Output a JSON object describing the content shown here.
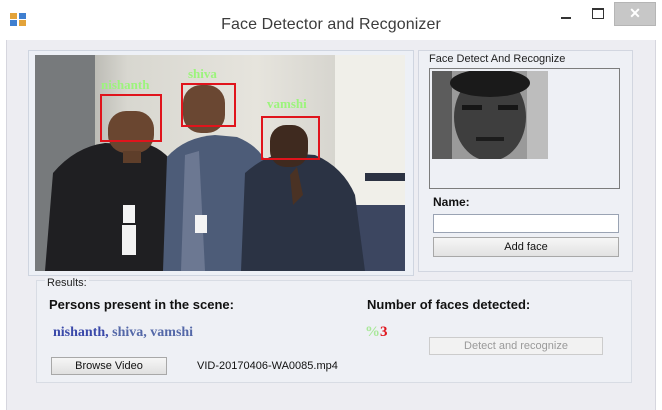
{
  "window": {
    "title": "Face Detector and Recgonizer",
    "close_glyph": "✕"
  },
  "video": {
    "labels": [
      "nishanth",
      "shiva",
      "vamshi"
    ]
  },
  "recognize_panel": {
    "title": "Face Detect And Recognize",
    "name_label": "Name:",
    "name_value": "",
    "add_face_label": "Add face"
  },
  "results": {
    "group_label": "Results:",
    "persons_label": "Persons present in the scene:",
    "persons_first": "nishanth,",
    "persons_rest": " shiva, vamshi",
    "faces_label": "Number of faces detected:",
    "faces_prefix": "%",
    "faces_count": "3",
    "detect_label": "Detect and recognize",
    "browse_label": "Browse Video",
    "file_name": "VID-20170406-WA0085.mp4"
  },
  "colors": {
    "face_box": "#e0141c",
    "name_tag": "#9cf47c",
    "persons_text": "#3a49a9"
  }
}
